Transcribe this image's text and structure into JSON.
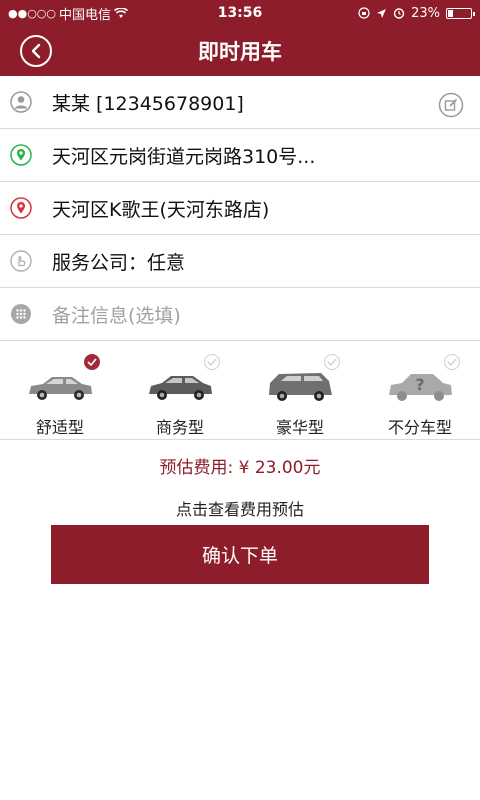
{
  "status_bar": {
    "carrier": "中国电信",
    "time": "13:56",
    "battery": "23%",
    "battery_level": 0.23
  },
  "nav": {
    "title": "即时用车",
    "back_icon": "chevron-left-icon"
  },
  "form": {
    "passenger": "某某 [12345678901]",
    "start_address": "天河区元岗街道元岗路310号...",
    "destination": "天河区K歌王(天河东路店)",
    "service_company": "服务公司：任意",
    "remark_placeholder": "备注信息(选填)"
  },
  "car_types": [
    {
      "label": "舒适型",
      "selected": true
    },
    {
      "label": "商务型",
      "selected": false
    },
    {
      "label": "豪华型",
      "selected": false
    },
    {
      "label": "不分车型",
      "selected": false
    }
  ],
  "fee": {
    "text": "预估费用: ¥ 23.00元",
    "view_link": "点击查看费用预估"
  },
  "confirm_label": "确认下单",
  "colors": {
    "brand": "#8e1d2b",
    "start_marker": "#2db34a",
    "end_marker": "#d9333f"
  }
}
